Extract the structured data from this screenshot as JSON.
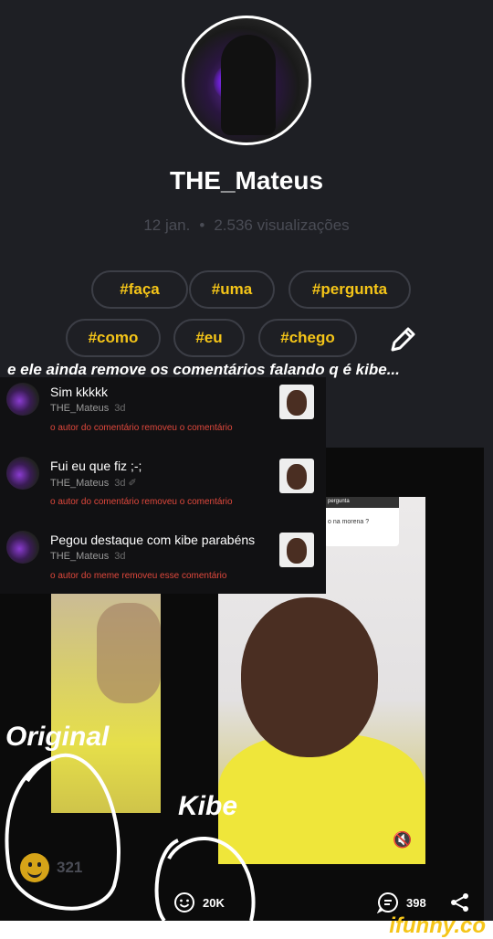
{
  "profile": {
    "username": "THE_Mateus",
    "date": "12 jan.",
    "separator": "•",
    "views": "2.536 visualizações"
  },
  "tags": [
    "#faça",
    "#uma",
    "#pergunta",
    "#como",
    "#eu",
    "#chego"
  ],
  "caption": "e ele ainda remove os comentários falando q é kibe...",
  "comments": [
    {
      "text": "Sim kkkkk",
      "user": "THE_Mateus",
      "age": "3d",
      "removed": "o autor do comentário removeu o comentário"
    },
    {
      "text": "Fui eu que fiz ;-;",
      "user": "THE_Mateus",
      "age": "3d ✐",
      "removed": "o autor do comentário removeu o comentário"
    },
    {
      "text": "Pegou destaque com kibe parabéns",
      "user": "THE_Mateus",
      "age": "3d",
      "removed": "o autor do meme removeu esse comentário"
    }
  ],
  "overlay": {
    "question_header": "pergunta",
    "question_text": "o na morena ?"
  },
  "labels": {
    "original": "Original",
    "kibe": "Kibe"
  },
  "reactions": {
    "left_count": "321",
    "smiles": "20K",
    "comments": "398"
  },
  "brand": "ifunny.co",
  "colors": {
    "accent": "#f5c518",
    "background": "#1e1f24",
    "removed": "#e0483c"
  },
  "icons": {
    "edit": "pencil-icon",
    "smile": "smile-icon",
    "comment": "comment-icon",
    "share": "share-icon",
    "mute": "mute-icon"
  }
}
